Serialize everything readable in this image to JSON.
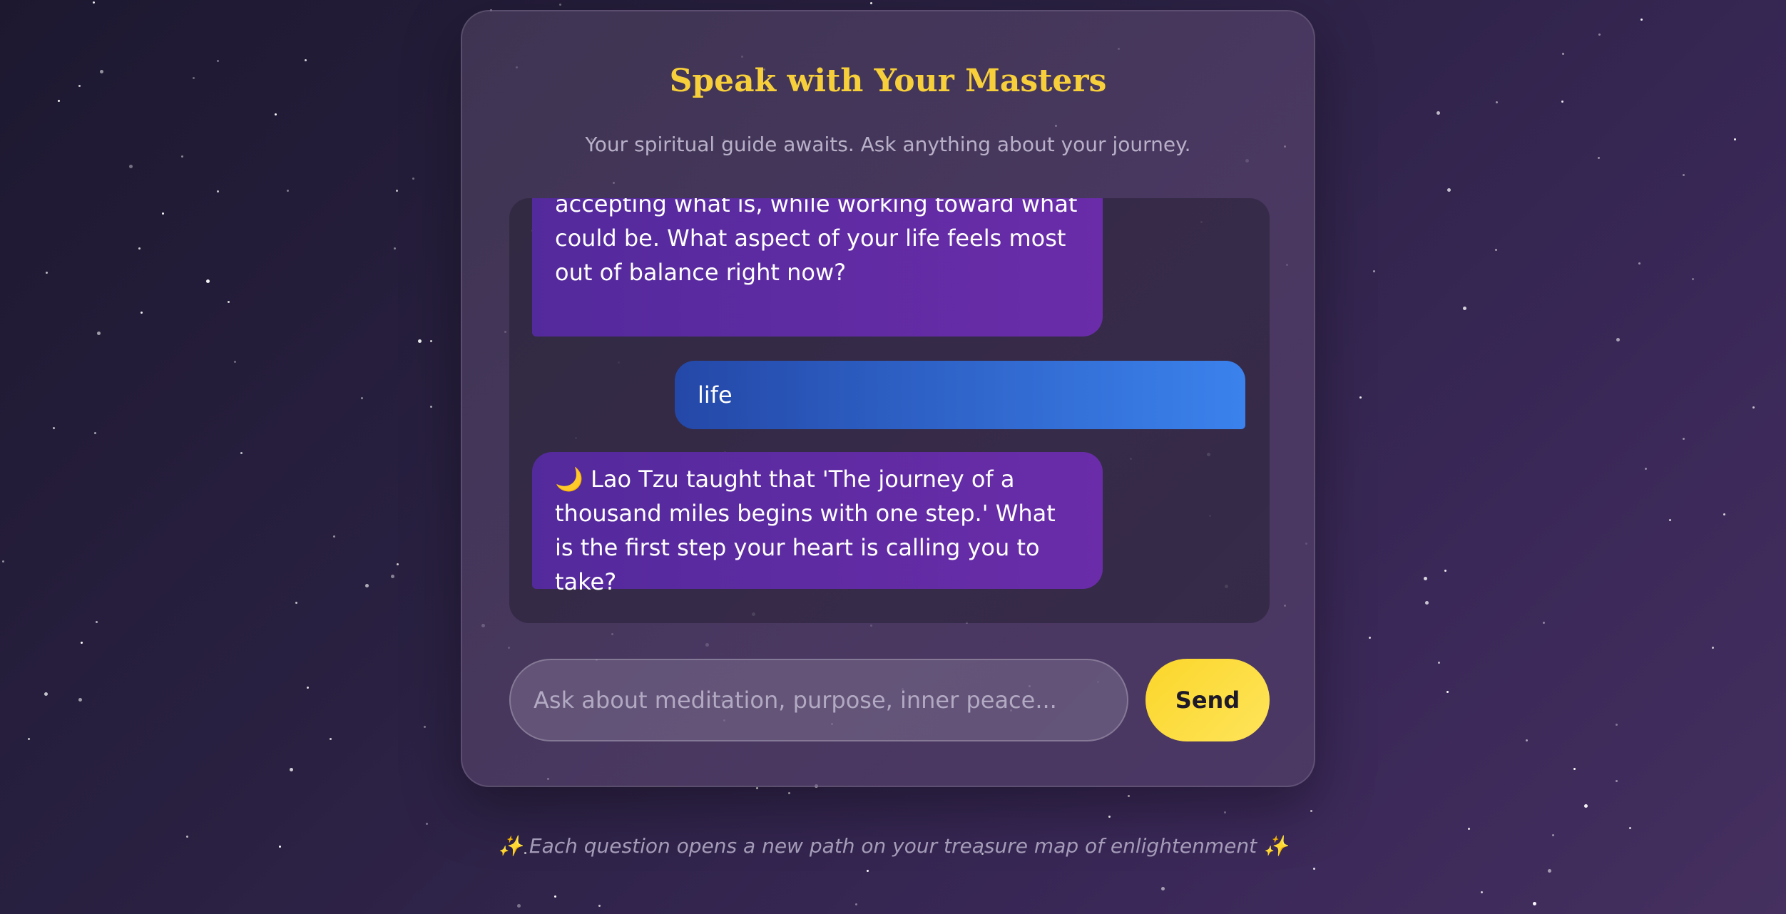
{
  "header": {
    "title": "Speak with Your Masters",
    "subtitle": "Your spiritual guide awaits. Ask anything about your journey."
  },
  "chat": {
    "messages": [
      {
        "role": "master",
        "text": "accepting what is, while working toward what could be. What aspect of your life feels most out of balance right now?"
      },
      {
        "role": "user",
        "text": "life"
      },
      {
        "role": "master",
        "icon": "crescent-moon-icon",
        "text": "🌙 Lao Tzu taught that 'The journey of a thousand miles begins with one step.' What is the first step your heart is calling you to take?"
      }
    ]
  },
  "composer": {
    "placeholder": "Ask about meditation, purpose, inner peace...",
    "value": "",
    "send_label": "Send"
  },
  "footer": {
    "text": "✨ Each question opens a new path on your treasure map of enlightenment ✨"
  },
  "colors": {
    "accent": "#f7cf3b",
    "master_bubble": "#5e2ba3",
    "user_bubble": "#3170d8",
    "send_button": "#fcd93a"
  }
}
